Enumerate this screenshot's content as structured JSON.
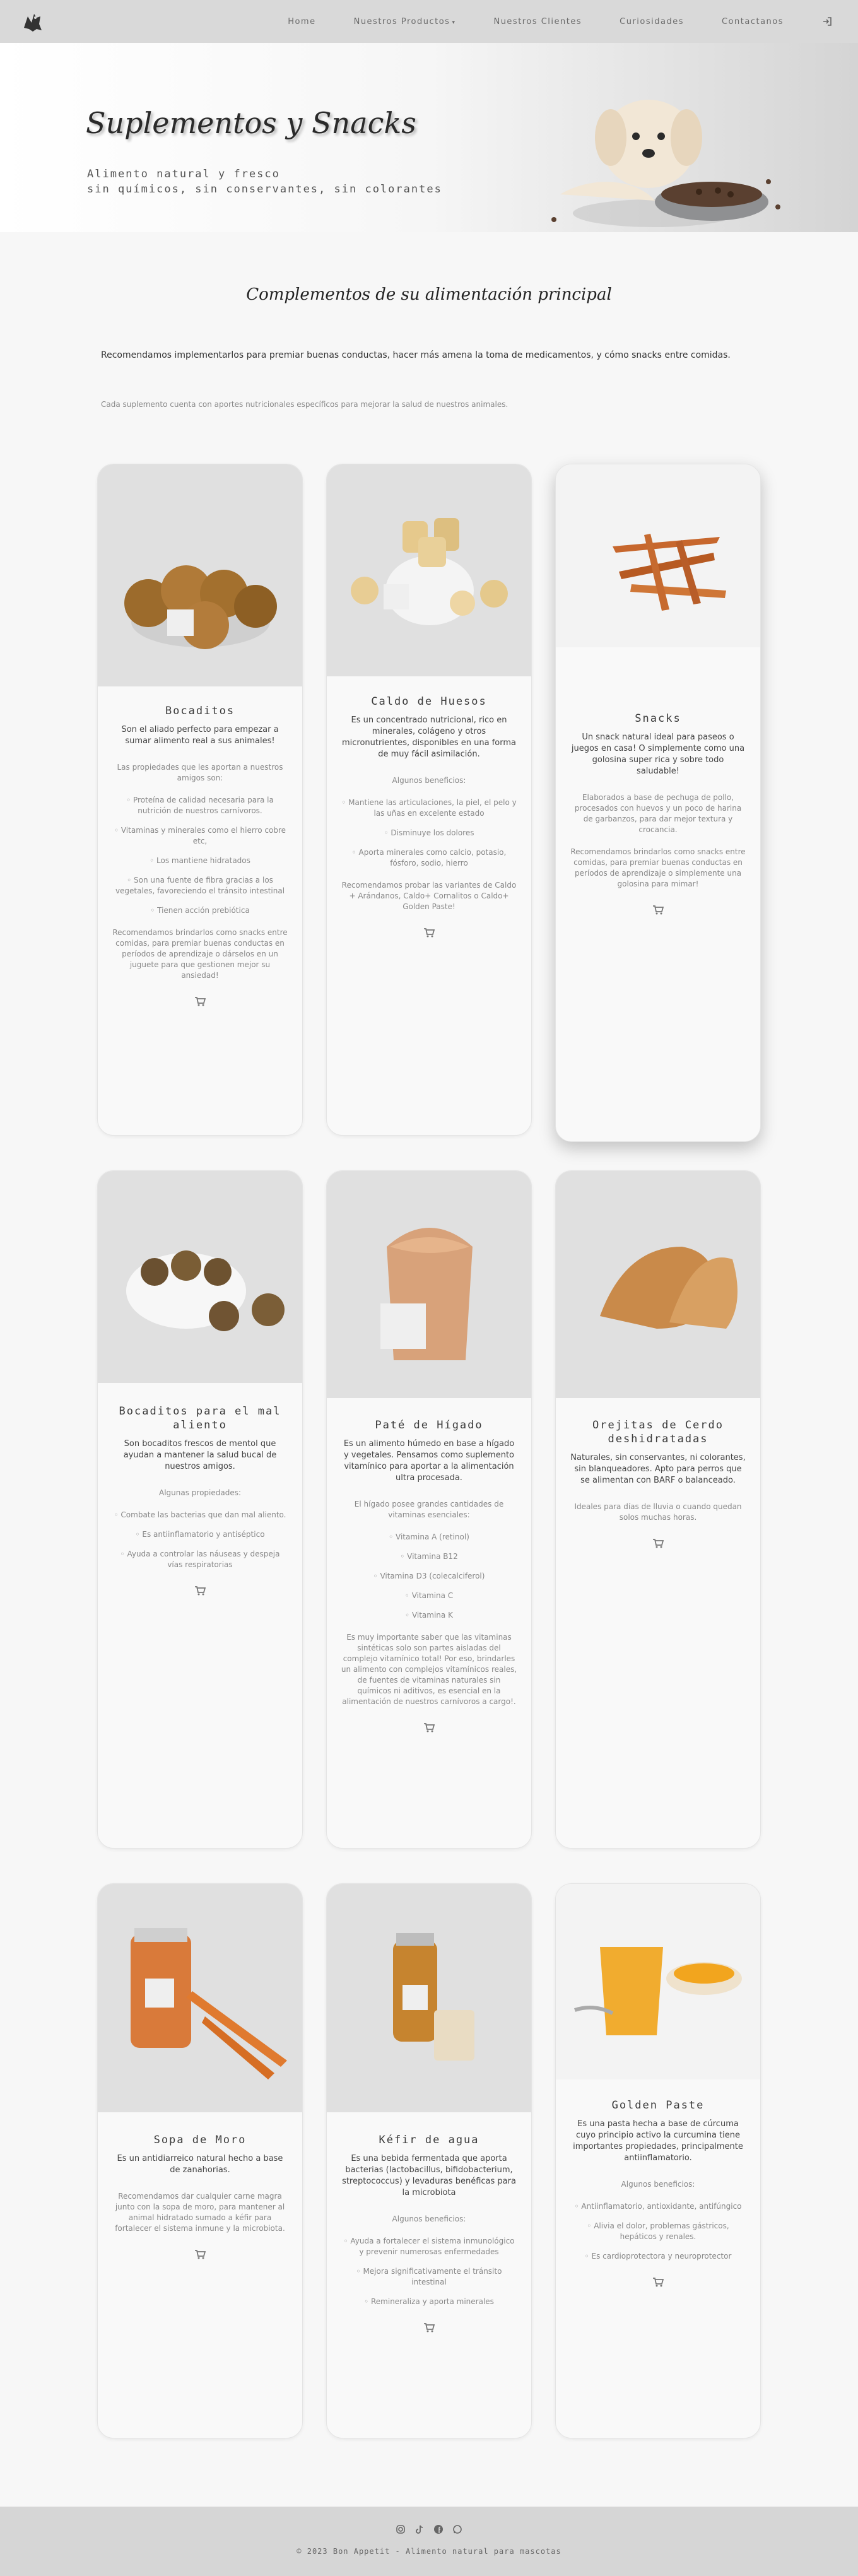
{
  "nav": {
    "items": [
      "Home",
      "Nuestros Productos",
      "Nuestros Clientes",
      "Curiosidades",
      "Contactanos"
    ],
    "products_caret": "▾",
    "login_icon": "login-icon"
  },
  "hero": {
    "title": "Suplementos y Snacks",
    "subtitle_1": "Alimento natural y fresco",
    "subtitle_2": "sin químicos, sin conservantes, sin colorantes"
  },
  "intro": {
    "title": "Complementos de su alimentación principal",
    "p1": "Recomendamos implementarlos para premiar buenas conductas, hacer más amena la toma de medicamentos, y cómo snacks entre comidas.",
    "p2": "Cada suplemento cuenta con aportes nutricionales específicos para mejorar la salud de nuestros animales."
  },
  "cards": [
    {
      "title": "Bocaditos",
      "tag": "Son el aliado perfecto para empezar a sumar alimento real a sus animales!",
      "text1": "Las propiedades que les aportan a nuestros amigos son:",
      "list": [
        "Proteína de calidad necesaria para la nutrición de nuestros carnívoros.",
        "Vitaminas y minerales como el hierro cobre etc,",
        "Los mantiene hidratados",
        "Son una fuente de fibra gracias a los vegetales, favoreciendo el tránsito intestinal",
        "Tienen acción prebiótica"
      ],
      "text2": "Recomendamos brindarlos como snacks entre comidas, para premiar buenas conductas en períodos de aprendizaje o dárselos en un juguete para que gestionen mejor su ansiedad!"
    },
    {
      "title": "Caldo de Huesos",
      "tag": "Es un concentrado nutricional, rico en minerales, colágeno y otros micronutrientes, disponibles en una forma de muy fácil asimilación.",
      "text1": "Algunos beneficios:",
      "list": [
        "Mantiene las articulaciones, la piel, el pelo y las uñas en excelente estado",
        "Disminuye los dolores",
        "Aporta minerales como calcio, potasio, fósforo, sodio, hierro"
      ],
      "text2": "Recomendamos probar las variantes de Caldo + Arándanos, Caldo+ Cornalitos o Caldo+ Golden Paste!"
    },
    {
      "title": "Snacks",
      "tag": "Un snack natural ideal para paseos o juegos en casa! O simplemente como una golosina super rica y sobre todo saludable!",
      "text1": "Elaborados a base de pechuga de pollo, procesados con huevos y un poco de harina de garbanzos, para dar mejor textura y crocancia.",
      "list": [],
      "text2": "Recomendamos brindarlos como snacks entre comidas, para premiar buenas conductas en períodos de aprendizaje o simplemente una golosina para mimar!"
    },
    {
      "title": "Bocaditos para el mal aliento",
      "tag": "Son bocaditos frescos de mentol que ayudan a mantener la salud bucal de nuestros amigos.",
      "text1": "Algunas propiedades:",
      "list": [
        "Combate las bacterias que dan mal aliento.",
        "Es antiinflamatorio y antiséptico",
        "Ayuda a controlar las náuseas y despeja vías respiratorias"
      ],
      "text2": ""
    },
    {
      "title": "Paté de Hígado",
      "tag": "Es un alimento húmedo en base a hígado y vegetales. Pensamos como suplemento vitamínico para aportar a la alimentación ultra procesada.",
      "text1": "El hígado posee grandes cantidades de vitaminas esenciales:",
      "list": [
        "Vitamina A (retinol)",
        "Vitamina B12",
        "Vitamina D3 (colecalciferol)",
        "Vitamina C",
        "Vitamina K"
      ],
      "text2": "Es muy importante saber que las vitaminas sintéticas solo son partes aisladas del complejo vitamínico total! Por eso, brindarles un alimento con complejos vitamínicos reales, de fuentes de vitaminas naturales sin químicos ni aditivos, es esencial en la alimentación de nuestros carnívoros a cargo!."
    },
    {
      "title": "Orejitas de Cerdo deshidratadas",
      "tag": "Naturales, sin conservantes, ni colorantes, sin blanqueadores. Apto para perros que se alimentan con BARF o balanceado.",
      "text1": "Ideales para días de lluvia o cuando quedan solos muchas horas.",
      "list": [],
      "text2": ""
    },
    {
      "title": "Sopa de Moro",
      "tag": "Es un antidiarreico natural hecho a base de zanahorias.",
      "text1": "Recomendamos dar cualquier carne magra junto con la sopa de moro, para mantener al animal hidratado sumado a kéfir para fortalecer el sistema inmune y la microbiota.",
      "list": [],
      "text2": ""
    },
    {
      "title": "Kéfir de agua",
      "tag": "Es una bebida fermentada que aporta bacterias (lactobacillus, bifidobacterium, streptococcus) y levaduras benéficas para la microbiota",
      "text1": "Algunos beneficios:",
      "list": [
        "Ayuda a fortalecer el sistema inmunológico y prevenir numerosas enfermedades",
        "Mejora significativamente el tránsito intestinal",
        "Remineraliza y aporta minerales"
      ],
      "text2": ""
    },
    {
      "title": "Golden Paste",
      "tag": "Es una pasta hecha a base de cúrcuma cuyo principio activo la curcumina tiene importantes propiedades, principalmente antiinflamatorio.",
      "text1": "Algunos beneficios:",
      "list": [
        "Antiinflamatorio, antioxidante, antifúngico",
        "Alivia el dolor, problemas gástricos, hepáticos y renales.",
        "Es cardioprotectora y neuroprotector"
      ],
      "text2": ""
    }
  ],
  "footer": {
    "copyright": "© 2023 Bon Appetit - Alimento natural para mascotas",
    "social_icons": [
      "instagram-icon",
      "tiktok-icon",
      "facebook-icon",
      "whatsapp-icon"
    ]
  }
}
